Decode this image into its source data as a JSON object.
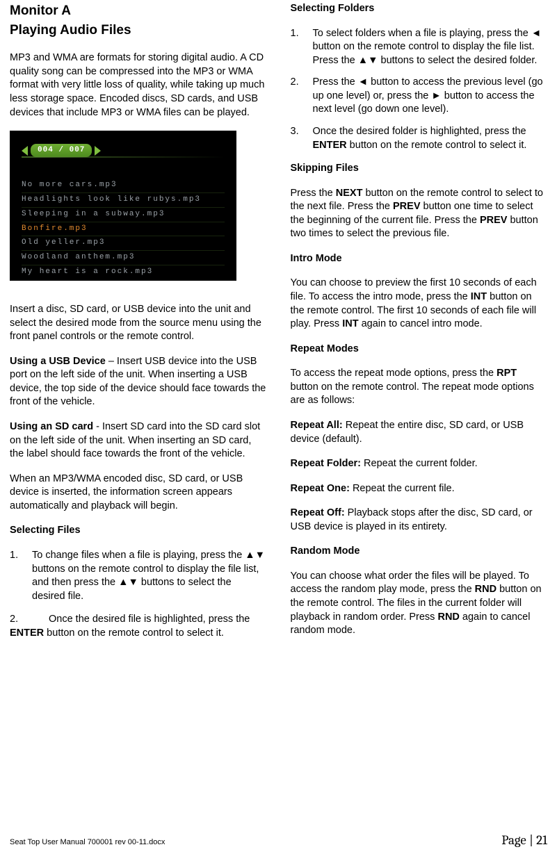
{
  "left": {
    "title": "Monitor A",
    "subtitle": "Playing Audio Files",
    "intro": "MP3 and WMA are formats for storing digital audio. A CD quality song can be compressed into the MP3 or WMA format with very little loss of quality, while taking up much less storage space. Encoded discs, SD cards, and USB devices that include MP3 or WMA files can be played.",
    "device": {
      "counter": "004 / 007",
      "tracks": [
        "No more cars.mp3",
        "Headlights look like rubys.mp3",
        "Sleeping in a subway.mp3",
        "Bonfire.mp3",
        "Old yeller.mp3",
        "Woodland anthem.mp3",
        "My heart is a rock.mp3"
      ],
      "active_index": 3
    },
    "insert": "Insert a disc, SD card, or USB device into the unit and select the desired mode from the source menu using the front panel controls or the remote control.",
    "usb_head": "Using a USB Device",
    "usb_body": " – Insert USB device into the USB port on the left side of the unit. When inserting a USB device, the top side of the device should face towards the front of the vehicle.",
    "sd_head": "Using an SD card",
    "sd_body": " - Insert SD card into the SD card slot on the left side of the unit. When inserting an SD card, the label should face towards the front of the vehicle.",
    "auto": "When an MP3/WMA encoded disc, SD card, or USB device is inserted, the information screen appears automatically and playback will begin.",
    "selfiles_head": "Selecting Files",
    "selfiles_1_num": "1.",
    "selfiles_1": "To change files when a file is playing, press the ▲▼ buttons on the remote control to display the file list, and then press the ▲▼ buttons to select the desired file.",
    "selfiles_2_num": "2.",
    "selfiles_2a": "Once the desired file is highlighted, press the ",
    "selfiles_2b": "ENTER",
    "selfiles_2c": " button on the remote control to select it."
  },
  "right": {
    "selfold_head": "Selecting Folders",
    "f1_num": "1.",
    "f1": "To select folders when a file is playing, press the ◄ button on the remote control to display the file list. Press the ▲▼ buttons to select the desired folder.",
    "f2_num": "2.",
    "f2": "Press the ◄ button to access the previous level (go up one level) or, press the ► button to access the next level (go down one level).",
    "f3_num": "3.",
    "f3a": "Once the desired folder is highlighted, press the ",
    "f3b": "ENTER",
    "f3c": " button on the remote control to select it.",
    "skip_head": "Skipping Files",
    "skip_a": "Press the ",
    "skip_b": "NEXT",
    "skip_c": " button on the remote control to select to the next file. Press the ",
    "skip_d": "PREV",
    "skip_e": " button one time to select the beginning of the current file. Press the ",
    "skip_f": "PREV",
    "skip_g": " button two times to select the previous file.",
    "intro_head": "Intro Mode",
    "intro_a": "You can choose to preview the first 10 seconds of each file. To access the intro mode, press the ",
    "intro_b": "INT",
    "intro_c": " button on the remote control. The first 10 seconds of each file will play. Press ",
    "intro_d": "INT",
    "intro_e": " again to cancel intro mode.",
    "rpt_head": "Repeat Modes",
    "rpt_a": "To access the repeat mode options, press the ",
    "rpt_b": "RPT",
    "rpt_c": " button on the remote control. The repeat mode options are as follows:",
    "rall_h": "Repeat All:",
    "rall_t": " Repeat the entire disc, SD card, or USB device (default).",
    "rfold_h": "Repeat Folder:",
    "rfold_t": " Repeat the current folder.",
    "rone_h": "Repeat One:",
    "rone_t": " Repeat the current file.",
    "roff_h": "Repeat Off:",
    "roff_t": " Playback stops after the disc, SD card, or USB device is played in its entirety.",
    "rnd_head": "Random Mode",
    "rnd_a": "You can choose what order the files will be played. To access the random play mode, press the ",
    "rnd_b": "RND",
    "rnd_c": " button on the remote control. The files in the current folder will playback in random order. Press ",
    "rnd_d": "RND",
    "rnd_e": " again to cancel random mode."
  },
  "footer": {
    "doc": "Seat Top User Manual 700001 rev 00-11.docx",
    "page": "Page | 21"
  }
}
